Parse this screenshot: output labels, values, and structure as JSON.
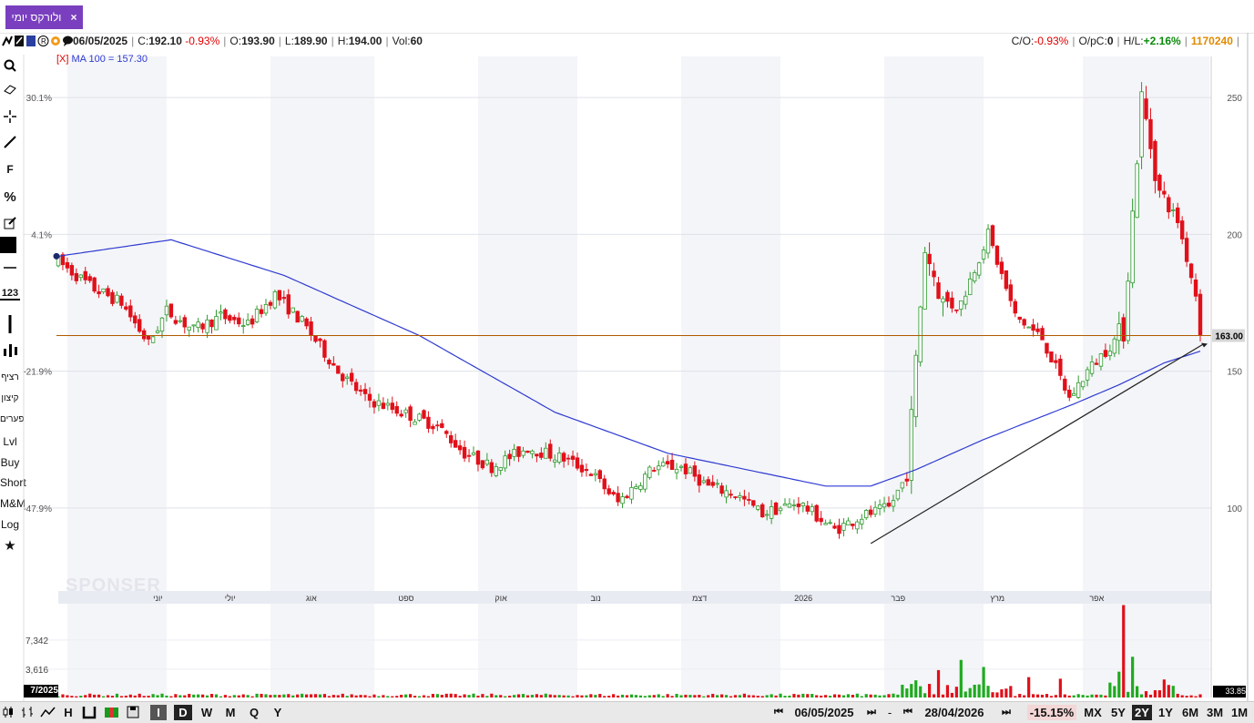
{
  "tab": {
    "label": "ולורקס יומי",
    "close": "×"
  },
  "info": {
    "date": "06/05/2025",
    "c_label": "C:",
    "c_value": "192.10",
    "c_change": "-0.93%",
    "o_label": "O:",
    "o_value": "193.90",
    "l_label": "L:",
    "l_value": "189.90",
    "h_label": "H:",
    "h_value": "194.00",
    "vol_label": "Vol:",
    "vol_value": "60",
    "co_label": "C/O:",
    "co_value": "-0.93%",
    "opc_label": "O/pC:",
    "opc_value": "0",
    "hl_label": "H/L:",
    "hl_value": "+2.16%",
    "id_value": "1170240"
  },
  "left_tools": {
    "f": "F",
    "percent": "%",
    "num": "123",
    "labels": [
      "רציף",
      "קיצון",
      "פערים",
      "Lvl",
      "Buy",
      "Short",
      "M&M",
      "Log"
    ]
  },
  "overlay": {
    "close_marker": "[X]",
    "ma_label": "MA 100 = 157.30"
  },
  "watermark": "SPONSER",
  "chart_data": {
    "type": "candlestick",
    "y_axis_right": {
      "range": [
        70,
        265
      ],
      "ticks": [
        100,
        150,
        200,
        250
      ]
    },
    "y_axis_left_percent_ticks": [
      {
        "label": "30.1%",
        "at": 250
      },
      {
        "label": "4.1%",
        "at": 200
      },
      {
        "label": "-21.9%",
        "at": 150
      },
      {
        "label": "-47.9%",
        "at": 100
      }
    ],
    "x_month_labels": [
      "יוני",
      "יולי",
      "אוג",
      "ספט",
      "אוק",
      "נוב",
      "דצמ",
      "2026",
      "פבר",
      "מרץ",
      "אפר"
    ],
    "last_price_label": "163.00",
    "last_price": 163,
    "ma_period": 100,
    "ma_value": 157.3,
    "trendline": {
      "from": [
        180,
        87
      ],
      "to": [
        253,
        160
      ]
    },
    "candles_count": 254,
    "price_keypoints": [
      [
        0,
        190
      ],
      [
        8,
        180
      ],
      [
        14,
        175
      ],
      [
        20,
        160
      ],
      [
        24,
        172
      ],
      [
        30,
        165
      ],
      [
        36,
        170
      ],
      [
        42,
        167
      ],
      [
        48,
        178
      ],
      [
        54,
        168
      ],
      [
        62,
        150
      ],
      [
        68,
        140
      ],
      [
        76,
        135
      ],
      [
        84,
        130
      ],
      [
        90,
        120
      ],
      [
        96,
        115
      ],
      [
        104,
        122
      ],
      [
        112,
        118
      ],
      [
        118,
        113
      ],
      [
        124,
        102
      ],
      [
        132,
        115
      ],
      [
        138,
        115
      ],
      [
        144,
        108
      ],
      [
        150,
        105
      ],
      [
        156,
        98
      ],
      [
        164,
        102
      ],
      [
        172,
        92
      ],
      [
        178,
        97
      ],
      [
        184,
        100
      ],
      [
        188,
        112
      ],
      [
        192,
        195
      ],
      [
        196,
        175
      ],
      [
        200,
        175
      ],
      [
        206,
        200
      ],
      [
        212,
        170
      ],
      [
        218,
        162
      ],
      [
        224,
        140
      ],
      [
        228,
        150
      ],
      [
        236,
        165
      ],
      [
        240,
        250
      ],
      [
        244,
        215
      ],
      [
        248,
        205
      ],
      [
        252,
        178
      ],
      [
        253,
        163
      ]
    ],
    "ma_keypoints": [
      [
        0,
        192
      ],
      [
        25,
        198
      ],
      [
        50,
        185
      ],
      [
        80,
        163
      ],
      [
        110,
        135
      ],
      [
        135,
        120
      ],
      [
        170,
        108
      ],
      [
        180,
        108
      ],
      [
        190,
        114
      ],
      [
        205,
        125
      ],
      [
        225,
        138
      ],
      [
        235,
        145
      ],
      [
        245,
        153
      ],
      [
        253,
        157.3
      ]
    ],
    "volume": {
      "ticks": [
        {
          "label": "7,342",
          "value": 7342
        },
        {
          "label": "3,616",
          "value": 3616
        }
      ],
      "max": 10000,
      "spikes": [
        [
          190,
          2200
        ],
        [
          195,
          3500
        ],
        [
          200,
          4800
        ],
        [
          205,
          3900
        ],
        [
          215,
          2600
        ],
        [
          222,
          2400
        ],
        [
          235,
          3300
        ],
        [
          236,
          11800
        ],
        [
          238,
          5200
        ],
        [
          245,
          2300
        ]
      ]
    }
  },
  "bottom": {
    "date_from": "06/05/2025",
    "dash": "-",
    "date_to": "28/04/2026",
    "change": "-15.15%",
    "ranges": [
      "MX",
      "5Y",
      "2Y",
      "1Y",
      "6M",
      "3M",
      "1M"
    ],
    "selected_range": "2Y",
    "periods": [
      "D",
      "W",
      "M",
      "Q",
      "Y"
    ],
    "left_value": "7/2025",
    "right_value": "33.85"
  }
}
